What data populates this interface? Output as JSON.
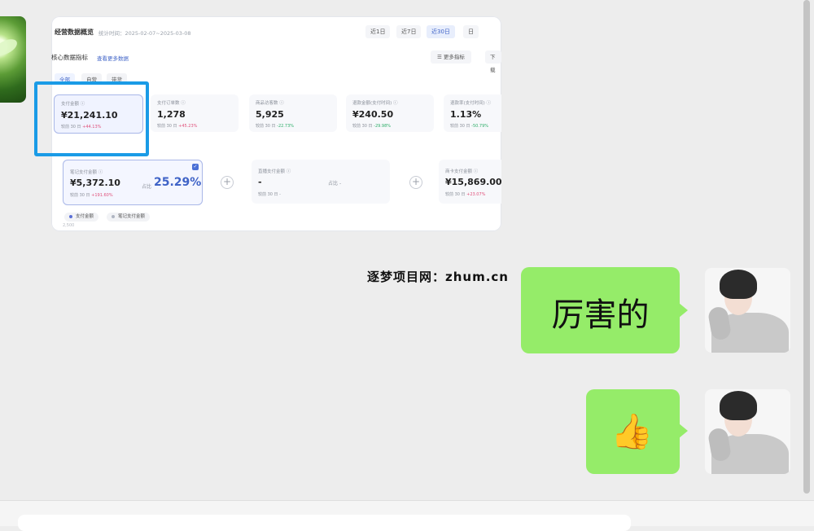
{
  "screenshot": {
    "title": "经营数据概览",
    "time_label": "统计时间：",
    "time_range": "2025-02-07~2025-03-08",
    "ranges": [
      "近1日",
      "近7日",
      "近30日",
      "日"
    ],
    "active_range": "近30日",
    "core_label": "核心数据指标",
    "core_link": "查看更多数据",
    "more_metrics": "更多指标",
    "download": "下载",
    "tabs": [
      "全部",
      "自营",
      "带货"
    ],
    "active_tab": "全部",
    "metrics": [
      {
        "label": "支付金额",
        "value": "¥21,241.10",
        "sub": "较前 30 日",
        "change": "+44.13%",
        "dir": "up"
      },
      {
        "label": "支付订单数",
        "value": "1,278",
        "sub": "较前 30 日",
        "change": "+45.23%",
        "dir": "up"
      },
      {
        "label": "商品访客数",
        "value": "5,925",
        "sub": "较前 30 日",
        "change": "-22.73%",
        "dir": "down"
      },
      {
        "label": "退款金额(支付时间)",
        "value": "¥240.50",
        "sub": "较前 30 日",
        "change": "-29.98%",
        "dir": "down"
      },
      {
        "label": "退款率(支付时间)",
        "value": "1.13%",
        "sub": "较前 30 日",
        "change": "-50.79%",
        "dir": "down"
      }
    ],
    "wide_cards": [
      {
        "label": "笔记支付金额",
        "value": "¥5,372.10",
        "sub": "较前 30 日",
        "change": "+191.60%",
        "ratio_label": "占比",
        "ratio": "25.29%"
      },
      {
        "label": "直播支付金额",
        "value": "-",
        "sub": "较前 30 日",
        "change": "-",
        "ratio_label": "占比",
        "ratio": "-"
      },
      {
        "label": "商卡支付金额",
        "value": "¥15,869.00",
        "sub": "较前 30 日",
        "change": "+23.07%"
      }
    ],
    "legend": [
      "支付金额",
      "笔记支付金额"
    ],
    "legend_colors": [
      "#5b6fd6",
      "#b0b6c2"
    ],
    "axis_tick": "2,500"
  },
  "watermark": "逐梦项目网：zhum.cn",
  "messages": [
    {
      "text": "厉害的"
    },
    {
      "emoji": "👍",
      "icon": "thumbs-up-icon"
    }
  ],
  "colors": {
    "bubble": "#95ec69",
    "highlight": "#1a9be6",
    "accent": "#3f63c7"
  }
}
